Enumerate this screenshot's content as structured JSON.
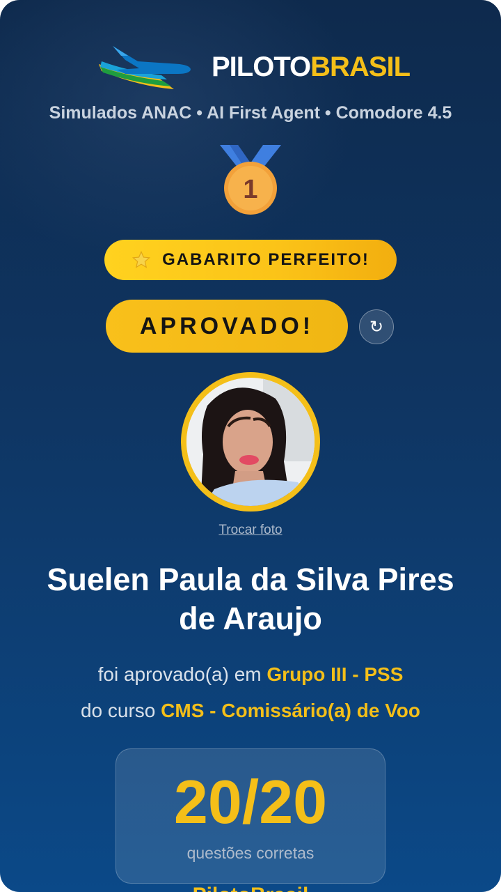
{
  "brand": {
    "name_part1": "PILOTO",
    "name_part2": "BRASIL",
    "subtitle": "Simulados ANAC • AI First Agent • Comodore 4.5",
    "footer_partial": "PilotoBrasil"
  },
  "medal": {
    "rank": "1",
    "icon": "first-place-medal-icon"
  },
  "badges": {
    "perfect": "GABARITO PERFEITO!",
    "perfect_icon": "star-icon",
    "status": "APROVADO!",
    "refresh_icon": "refresh-icon",
    "refresh_glyph": "↻"
  },
  "profile": {
    "change_photo": "Trocar foto",
    "name": "Suelen Paula da Silva Pires de Araujo"
  },
  "approval": {
    "prefix1": "foi aprovado(a) em ",
    "group": "Grupo III - PSS",
    "prefix2": "do curso ",
    "course": "CMS - Comissário(a) de Voo"
  },
  "score": {
    "value": "20/20",
    "label": "questões corretas",
    "correct": 20,
    "total": 20
  },
  "colors": {
    "accent": "#f4bf19",
    "background_top": "#0e2a4d",
    "background_bottom": "#0b4988",
    "medal_ribbon": "#3f7fe0",
    "medal_gold": "#f2a13a"
  }
}
